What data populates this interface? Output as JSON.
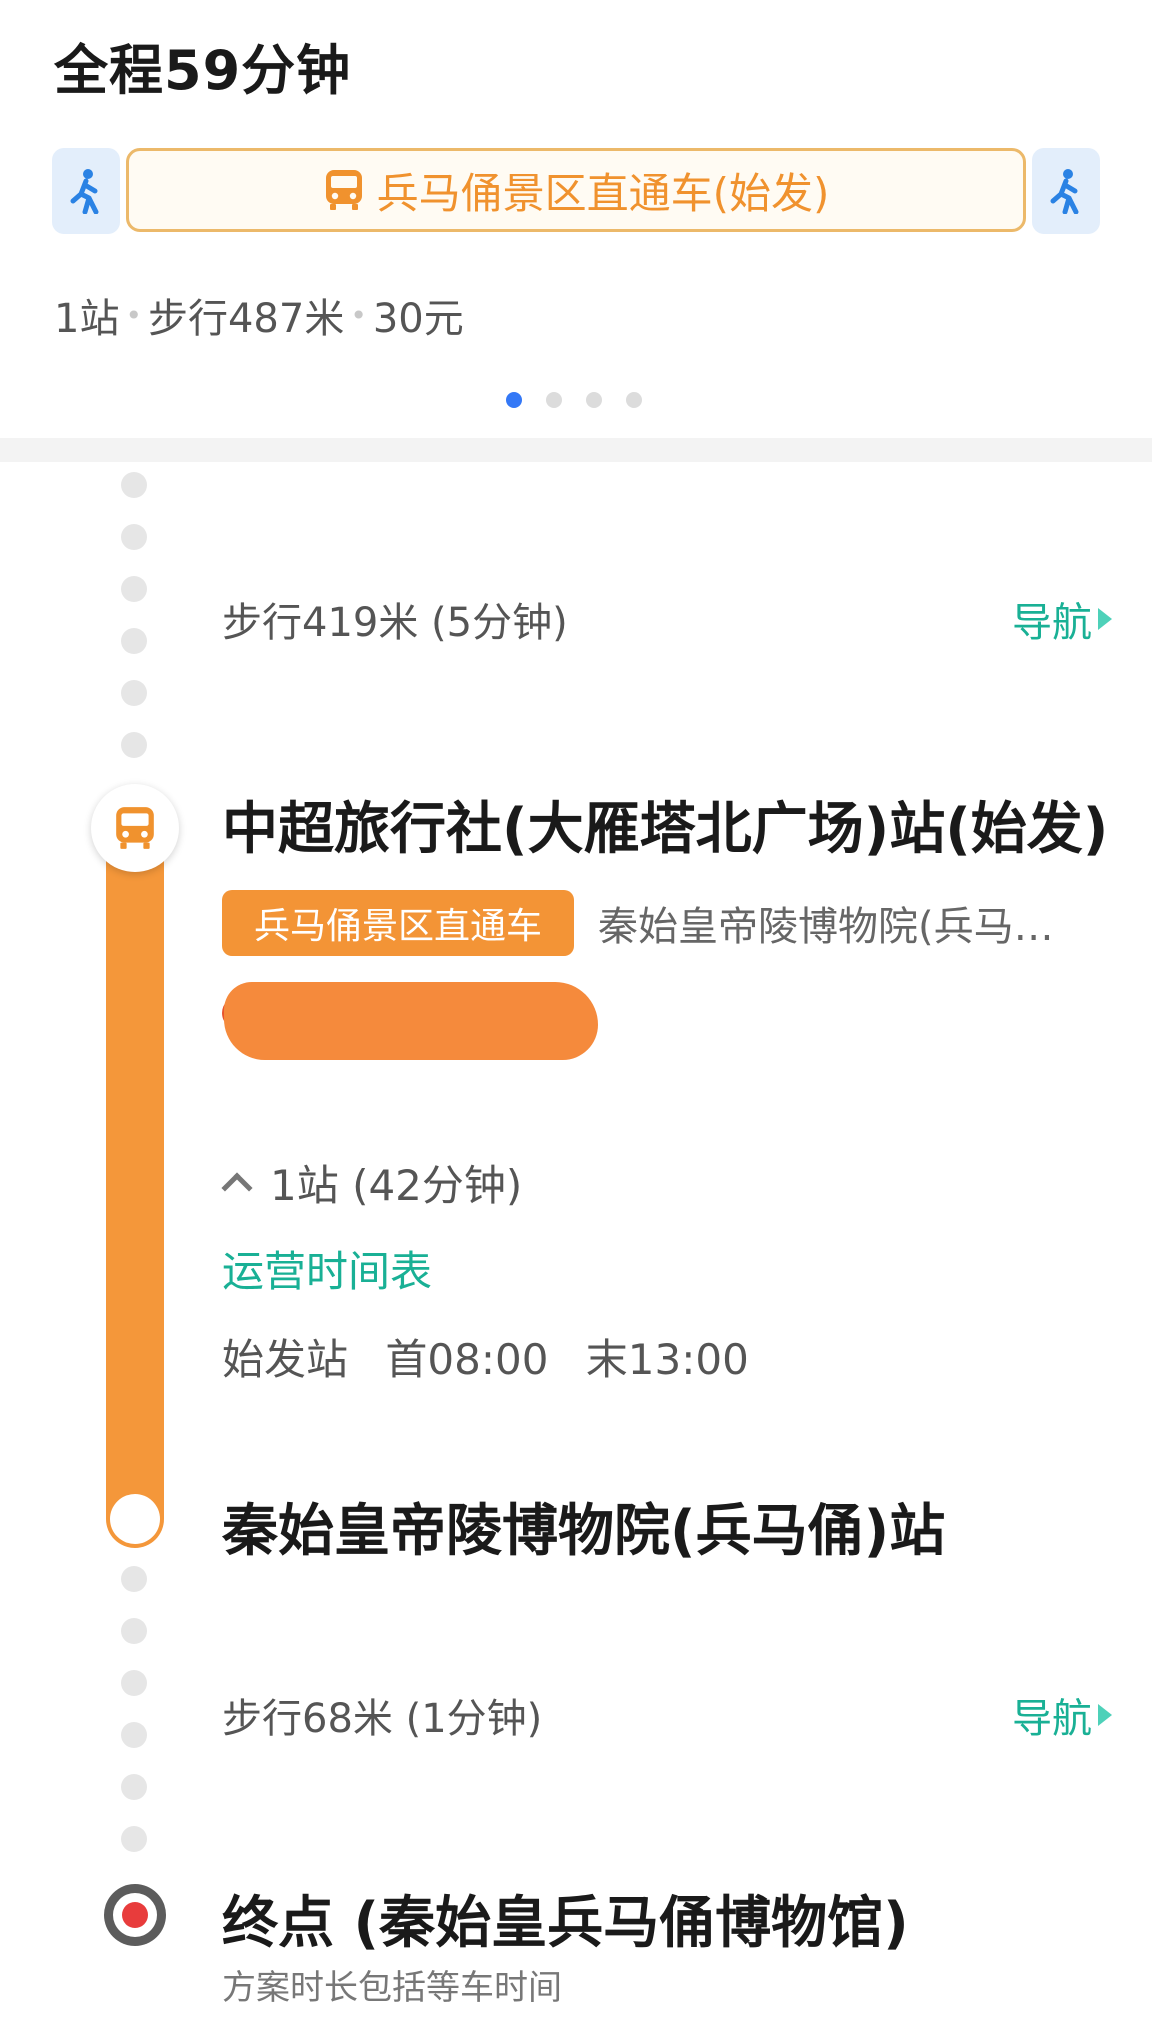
{
  "summary": {
    "total_time": "全程59分钟",
    "bus_chip_label": "兵马俑景区直通车(始发)",
    "meta": {
      "stops": "1站",
      "walk": "步行487米",
      "fare": "30元"
    },
    "page_dots": 4,
    "active_page": 1
  },
  "steps": {
    "walk1": {
      "text": "步行419米 (5分钟)",
      "nav_label": "导航"
    },
    "board": {
      "stop_name": "中超旅行社(大雁塔北广场)站(始发)",
      "line_badge": "兵马俑景区直通车",
      "direction": "秦始皇帝陵博物院(兵马俑)方向",
      "stops_toggle": "1站 (42分钟)",
      "timetable_label": "运营时间表",
      "first_station": "始发站",
      "first_bus": "首08:00",
      "last_bus": "末13:00"
    },
    "alight": {
      "stop_name": "秦始皇帝陵博物院(兵马俑)站"
    },
    "walk2": {
      "text": "步行68米 (1分钟)",
      "nav_label": "导航"
    },
    "destination": {
      "title": "终点 (秦始皇兵马俑博物馆)",
      "note": "方案时长包括等车时间"
    }
  },
  "colors": {
    "bus_orange": "#f4973a",
    "nav_green": "#19b095",
    "active_dot_blue": "#3478f6",
    "walk_chip_bg": "#e3eefb"
  }
}
